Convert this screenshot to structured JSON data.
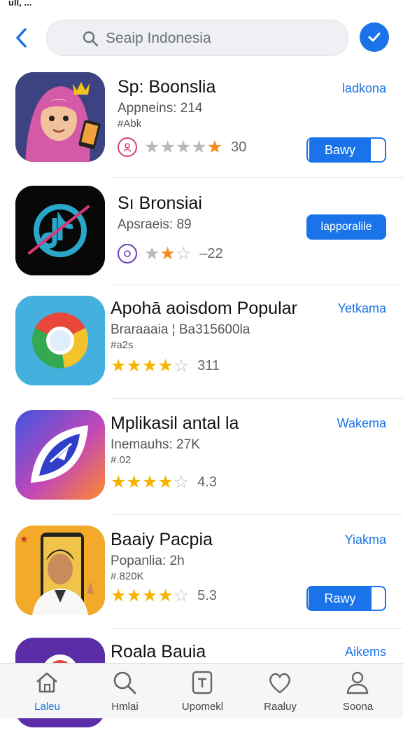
{
  "status_bar": {
    "left": "ull, ..."
  },
  "search": {
    "value": "Seaip Indonesia"
  },
  "apps": [
    {
      "title": "Sp: Boonslia",
      "subtitle": "Appneins: 214",
      "meta": "#Abk",
      "rating_score": "30",
      "link": "ladkona",
      "button": "Bawy"
    },
    {
      "title": "Sı Bronsiai",
      "subtitle": "Apsraeis: 89",
      "rating_score": "–22",
      "button": "lapporalile"
    },
    {
      "title": "Apohā aoisdom Popular",
      "subtitle": "Braraaaia ¦ Ba315600la",
      "meta": "#a2s",
      "rating_score": "311",
      "link": "Yetkama"
    },
    {
      "title": "Mplikasil antal la",
      "subtitle": "Inemauhs: 27K",
      "meta": "#.02",
      "rating_score": "4.3",
      "link": "Wakema"
    },
    {
      "title": "Baaiy Pacpia",
      "subtitle": "Popanlia: 2h",
      "meta": "#.820K",
      "rating_score": "5.3",
      "link": "Yiakma",
      "button": "Rawy"
    },
    {
      "title": "Roala Bauia",
      "link": "Aikems"
    }
  ],
  "ratings": [
    {
      "filled": 4,
      "half": 1,
      "outline": 0
    },
    {
      "filled": 1,
      "half": 1,
      "outline": 1
    },
    {
      "filled": 4,
      "half": 0,
      "outline": 1
    },
    {
      "filled": 4,
      "half": 0,
      "outline": 1
    },
    {
      "filled": 4,
      "half": 0,
      "outline": 1
    }
  ],
  "nav": [
    {
      "label": "Laleu",
      "icon": "home-icon"
    },
    {
      "label": "Hmlai",
      "icon": "search-icon"
    },
    {
      "label": "Upomekl",
      "icon": "document-icon"
    },
    {
      "label": "Raaluy",
      "icon": "heart-icon"
    },
    {
      "label": "Soona",
      "icon": "profile-icon"
    }
  ],
  "colors": {
    "accent": "#1a73e8",
    "star": "#f5b400",
    "star_gray": "#b8b8b8"
  }
}
